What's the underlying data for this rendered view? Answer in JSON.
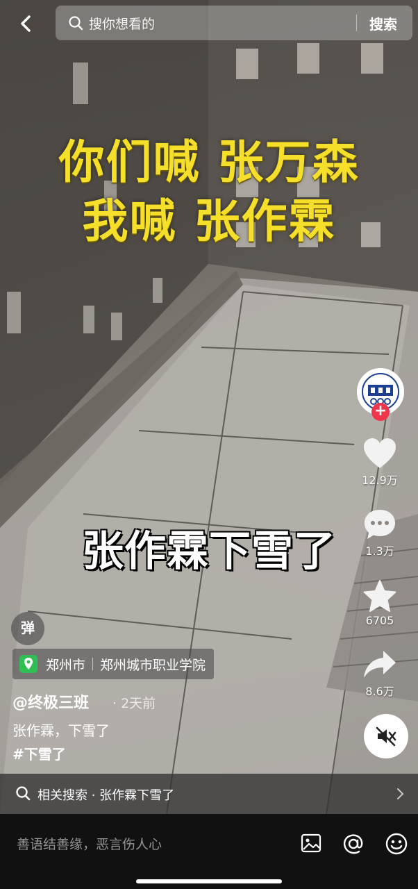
{
  "search": {
    "placeholder": "搜你想看的",
    "button_label": "搜索"
  },
  "video": {
    "caption_line1": "你们喊  张万森",
    "caption_line2": "我喊  张作霖",
    "caption_mid": "张作霖下雪了"
  },
  "rail": {
    "like_count": "12.9万",
    "comment_count": "1.3万",
    "favorite_count": "6705",
    "share_count": "8.6万",
    "follow_label": "+"
  },
  "info": {
    "danmu_label": "弹",
    "location_city": "郑州市",
    "location_place": "郑州城市职业学院",
    "author": "@终极三班",
    "posted": "· 2天前",
    "description": "张作霖，下雪了",
    "hashtag": "#下雪了"
  },
  "related_search": {
    "text": "相关搜索 · 张作霖下雪了"
  },
  "comment_bar": {
    "placeholder": "善语结善缘，恶言伤人心"
  },
  "icons": {
    "back": "back-arrow-icon",
    "search": "search-icon",
    "like": "heart-icon",
    "comment": "comment-bubble-icon",
    "favorite": "star-icon",
    "share": "share-arrow-icon",
    "mute": "speaker-muted-icon",
    "location": "location-pin-icon",
    "image": "image-icon",
    "mention": "at-icon",
    "emoji": "emoji-icon"
  },
  "colors": {
    "caption_yellow": "#f5df2a",
    "follow_red": "#f0354a",
    "location_green": "#2fbf53"
  }
}
